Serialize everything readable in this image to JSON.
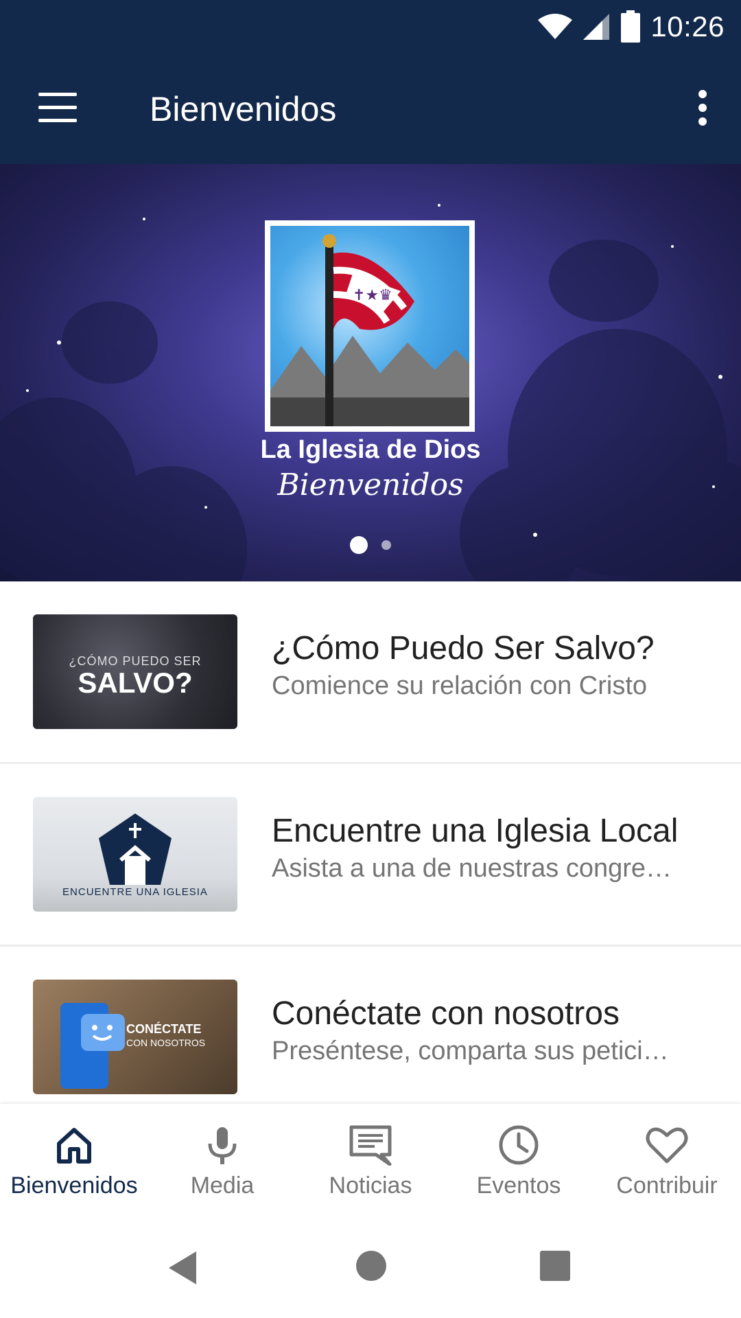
{
  "status_bar": {
    "time": "10:26"
  },
  "app_bar": {
    "title": "Bienvenidos"
  },
  "hero": {
    "brand_name": "La Iglesia de Dios",
    "brand_tagline": "Bienvenidos"
  },
  "carousel": {
    "current_slide": 1,
    "total_slides": 2
  },
  "list": {
    "items": [
      {
        "title": "¿Cómo Puedo Ser Salvo?",
        "subtitle": "Comience su relación con Cristo",
        "thumb_top": "¿CÓMO PUEDO SER",
        "thumb_main": "SALVO?"
      },
      {
        "title": "Encuentre una Iglesia Local",
        "subtitle": "Asista a una de nuestras congre…",
        "thumb_text": "ENCUENTRE UNA IGLESIA"
      },
      {
        "title": "Conéctate con nosotros",
        "subtitle": "Preséntese, comparta sus petici…",
        "thumb_main": "CONÉCTATE",
        "thumb_sub": "CON NOSOTROS"
      }
    ]
  },
  "bottom_nav": {
    "items": [
      {
        "label": "Bienvenidos",
        "icon": "home-icon",
        "active": true
      },
      {
        "label": "Media",
        "icon": "microphone-icon",
        "active": false
      },
      {
        "label": "Noticias",
        "icon": "message-icon",
        "active": false
      },
      {
        "label": "Eventos",
        "icon": "clock-icon",
        "active": false
      },
      {
        "label": "Contribuir",
        "icon": "heart-icon",
        "active": false
      }
    ]
  },
  "colors": {
    "primary": "#13294b",
    "inactive": "#757575",
    "text": "#212121"
  }
}
